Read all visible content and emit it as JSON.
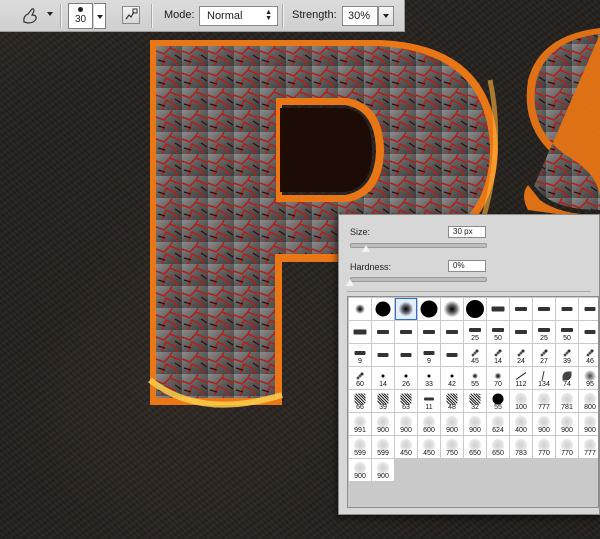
{
  "toolbar": {
    "tool_icon": "smudge-finger-icon",
    "brush_size_value": "30",
    "toggle_panel_icon": "brush-panel-toggle-icon",
    "mode_label": "Mode:",
    "mode_value": "Normal",
    "strength_label": "Strength:",
    "strength_value": "30%"
  },
  "brush_picker": {
    "size_label": "Size:",
    "size_value": "30 px",
    "size_level": 0.12,
    "hardness_label": "Hardness:",
    "hardness_value": "0%",
    "hardness_level": 0.0,
    "selected_index": 2,
    "presets": [
      {
        "type": "soft",
        "size": "",
        "diameter": 10
      },
      {
        "type": "hard",
        "size": "",
        "diameter": 15
      },
      {
        "type": "soft",
        "size": "",
        "diameter": 15
      },
      {
        "type": "hard",
        "size": "",
        "diameter": 17
      },
      {
        "type": "soft",
        "size": "",
        "diameter": 17
      },
      {
        "type": "hard",
        "size": "",
        "diameter": 18
      },
      {
        "type": "pencil",
        "size": "",
        "diameter": 9
      },
      {
        "type": "pencil",
        "size": "",
        "diameter": 8
      },
      {
        "type": "pencil",
        "size": "",
        "diameter": 8
      },
      {
        "type": "pencil",
        "size": "",
        "diameter": 7
      },
      {
        "type": "pencil",
        "size": "",
        "diameter": 7
      },
      {
        "type": "pencil",
        "size": "",
        "diameter": 9
      },
      {
        "type": "pencil",
        "size": "",
        "diameter": 8
      },
      {
        "type": "pencil",
        "size": "",
        "diameter": 8
      },
      {
        "type": "pencil",
        "size": "",
        "diameter": 8
      },
      {
        "type": "pencil",
        "size": "",
        "diameter": 8
      },
      {
        "type": "pencil",
        "size": "25",
        "diameter": 8
      },
      {
        "type": "pencil",
        "size": "50",
        "diameter": 8
      },
      {
        "type": "pencil",
        "size": "",
        "diameter": 8
      },
      {
        "type": "pencil",
        "size": "25",
        "diameter": 8
      },
      {
        "type": "pencil",
        "size": "50",
        "diameter": 8
      },
      {
        "type": "pencil",
        "size": "",
        "diameter": 7
      },
      {
        "type": "pencil",
        "size": "9",
        "diameter": 7
      },
      {
        "type": "pencil",
        "size": "",
        "diameter": 7
      },
      {
        "type": "pencil",
        "size": "",
        "diameter": 7
      },
      {
        "type": "pencil",
        "size": "9",
        "diameter": 7
      },
      {
        "type": "pencil",
        "size": "",
        "diameter": 7
      },
      {
        "type": "fleck",
        "size": "45",
        "diameter": 10
      },
      {
        "type": "fleck",
        "size": "14",
        "diameter": 10
      },
      {
        "type": "fleck",
        "size": "24",
        "diameter": 10
      },
      {
        "type": "fleck",
        "size": "27",
        "diameter": 10
      },
      {
        "type": "fleck",
        "size": "39",
        "diameter": 10
      },
      {
        "type": "fleck",
        "size": "46",
        "diameter": 10
      },
      {
        "type": "fleck",
        "size": "60",
        "diameter": 10
      },
      {
        "type": "hard",
        "size": "14",
        "diameter": 3
      },
      {
        "type": "hard",
        "size": "26",
        "diameter": 3
      },
      {
        "type": "hard",
        "size": "33",
        "diameter": 3
      },
      {
        "type": "hard",
        "size": "42",
        "diameter": 3
      },
      {
        "type": "soft",
        "size": "55",
        "diameter": 6
      },
      {
        "type": "soft",
        "size": "70",
        "diameter": 7
      },
      {
        "type": "line",
        "size": "112",
        "diameter": 12
      },
      {
        "type": "grass",
        "size": "134",
        "diameter": 10
      },
      {
        "type": "leaf",
        "size": "74",
        "diameter": 9
      },
      {
        "type": "airbrush",
        "size": "95",
        "diameter": 12
      },
      {
        "type": "texture",
        "size": "66",
        "diameter": 11
      },
      {
        "type": "texture",
        "size": "39",
        "diameter": 11
      },
      {
        "type": "texture",
        "size": "63",
        "diameter": 11
      },
      {
        "type": "pencil",
        "size": "11",
        "diameter": 6
      },
      {
        "type": "texture",
        "size": "48",
        "diameter": 11
      },
      {
        "type": "texture",
        "size": "32",
        "diameter": 11
      },
      {
        "type": "hard",
        "size": "55",
        "diameter": 11
      },
      {
        "type": "pale",
        "size": "100",
        "diameter": 13
      },
      {
        "type": "pale",
        "size": "777",
        "diameter": 13
      },
      {
        "type": "pale",
        "size": "781",
        "diameter": 13
      },
      {
        "type": "pale",
        "size": "800",
        "diameter": 13
      },
      {
        "type": "pale",
        "size": "991",
        "diameter": 13
      },
      {
        "type": "pale",
        "size": "900",
        "diameter": 13
      },
      {
        "type": "pale",
        "size": "900",
        "diameter": 13
      },
      {
        "type": "pale",
        "size": "600",
        "diameter": 13
      },
      {
        "type": "pale",
        "size": "900",
        "diameter": 13
      },
      {
        "type": "pale",
        "size": "900",
        "diameter": 13
      },
      {
        "type": "pale",
        "size": "624",
        "diameter": 13
      },
      {
        "type": "pale",
        "size": "400",
        "diameter": 13
      },
      {
        "type": "pale",
        "size": "900",
        "diameter": 13
      },
      {
        "type": "pale",
        "size": "900",
        "diameter": 13
      },
      {
        "type": "pale",
        "size": "900",
        "diameter": 13
      },
      {
        "type": "pale",
        "size": "599",
        "diameter": 13
      },
      {
        "type": "pale",
        "size": "599",
        "diameter": 13
      },
      {
        "type": "pale",
        "size": "450",
        "diameter": 13
      },
      {
        "type": "pale",
        "size": "450",
        "diameter": 13
      },
      {
        "type": "pale",
        "size": "750",
        "diameter": 13
      },
      {
        "type": "pale",
        "size": "650",
        "diameter": 13
      },
      {
        "type": "pale",
        "size": "650",
        "diameter": 13
      },
      {
        "type": "pale",
        "size": "783",
        "diameter": 13
      },
      {
        "type": "pale",
        "size": "770",
        "diameter": 13
      },
      {
        "type": "pale",
        "size": "770",
        "diameter": 13
      },
      {
        "type": "pale",
        "size": "777",
        "diameter": 13
      },
      {
        "type": "pale",
        "size": "900",
        "diameter": 13
      },
      {
        "type": "pale",
        "size": "900",
        "diameter": 13
      }
    ]
  }
}
